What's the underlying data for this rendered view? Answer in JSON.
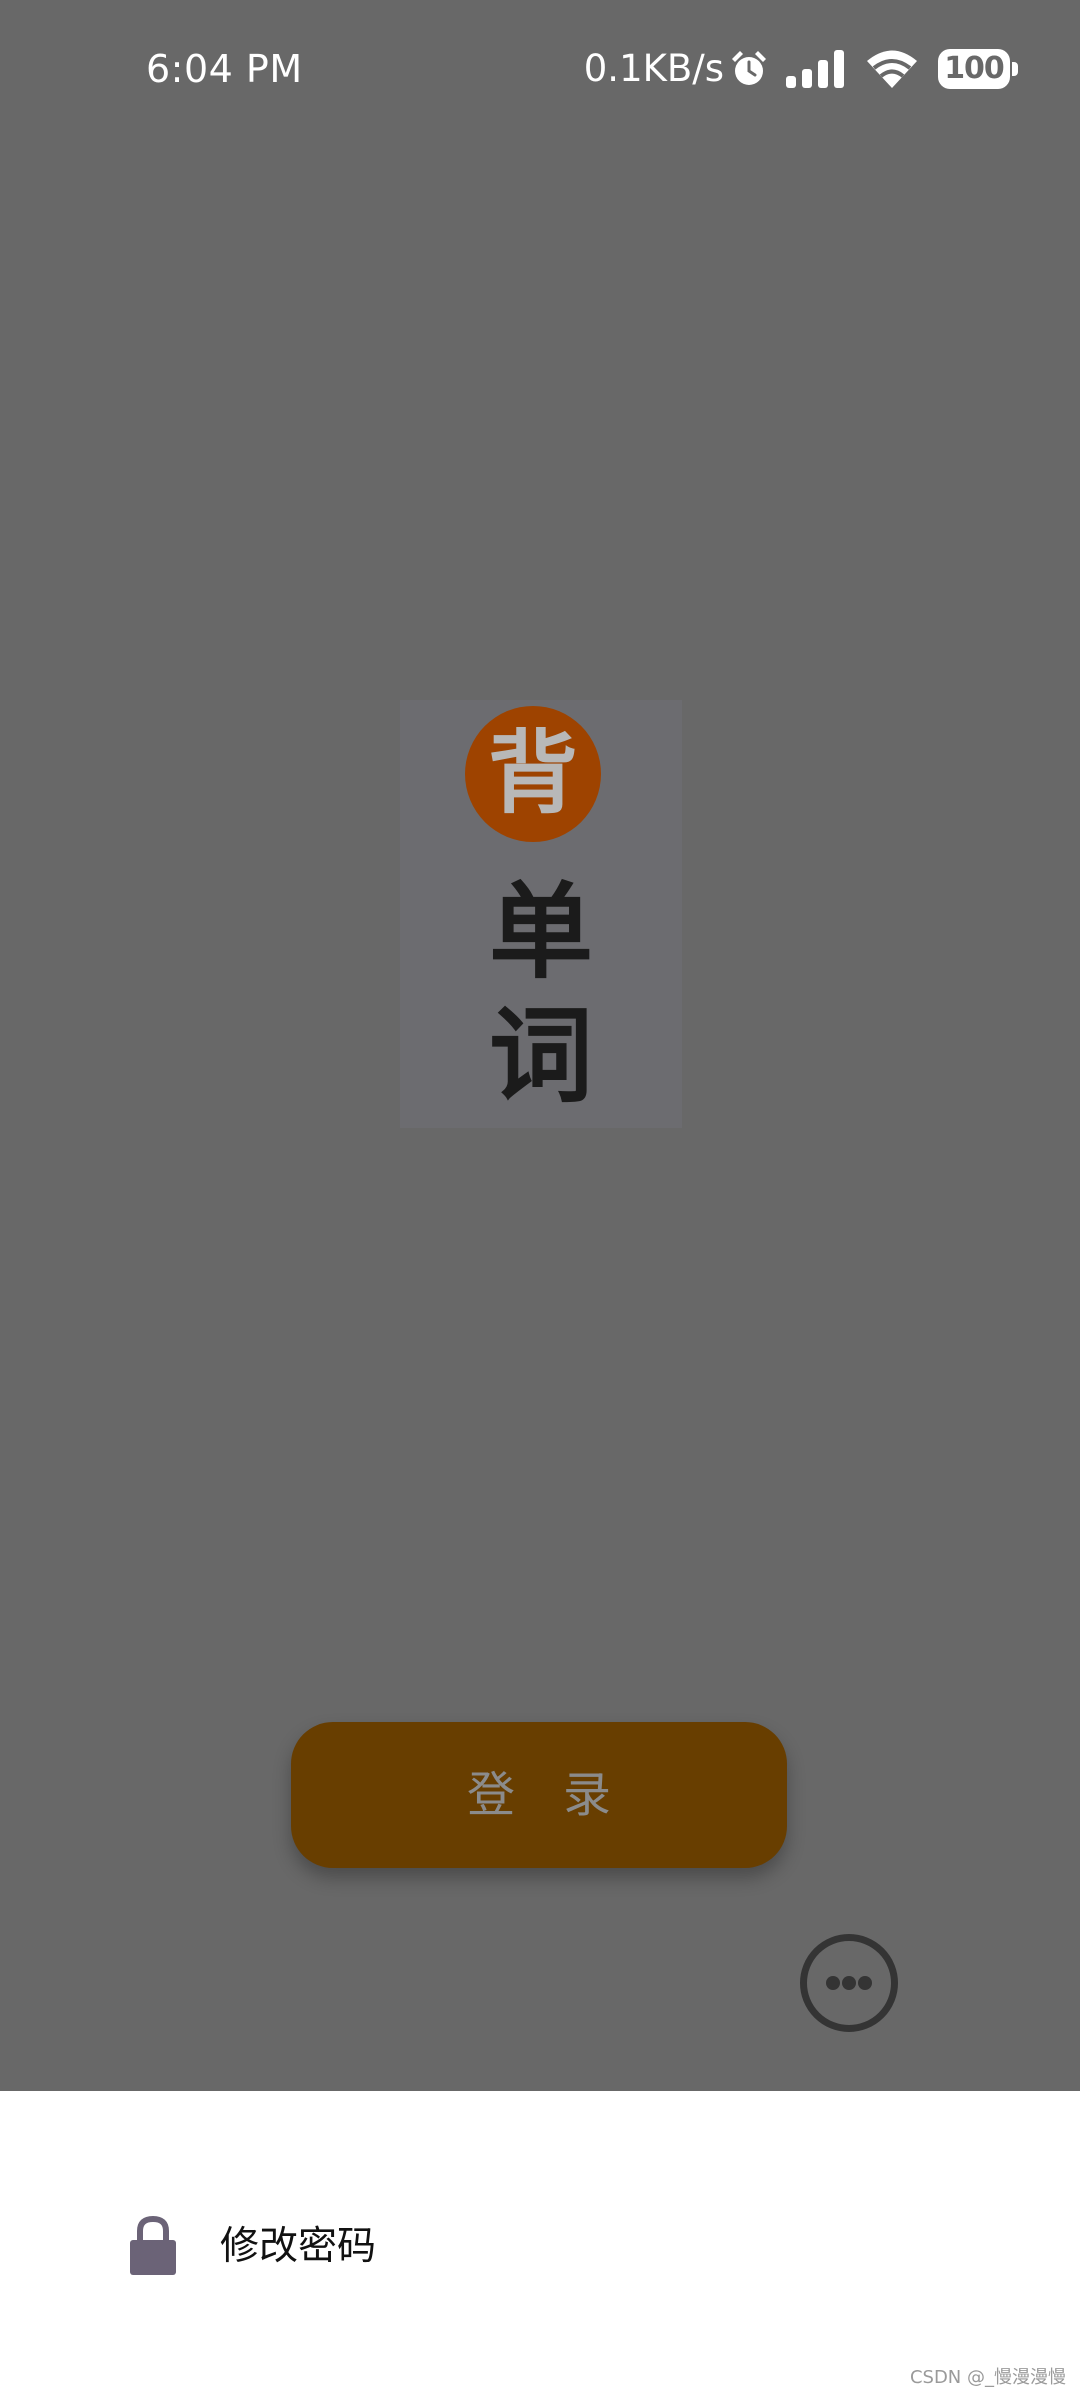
{
  "status_bar": {
    "time": "6:04 PM",
    "net_speed": "0.1KB/s",
    "icons": [
      "alarm-icon",
      "signal-icon",
      "wifi-icon",
      "battery-icon"
    ],
    "battery": "100"
  },
  "logo": {
    "glyph": "背",
    "word_1": "单",
    "word_2": "词",
    "colors": {
      "circle": "#9e4300",
      "text": "#1b1b1b"
    }
  },
  "login": {
    "label": "登录",
    "color": "#683e00"
  },
  "more": {
    "icon": "more-horizontal-icon"
  },
  "sheet": {
    "items": [
      {
        "icon": "lock-icon",
        "label": "修改密码"
      }
    ]
  },
  "watermark": "CSDN @_慢漫漫慢"
}
